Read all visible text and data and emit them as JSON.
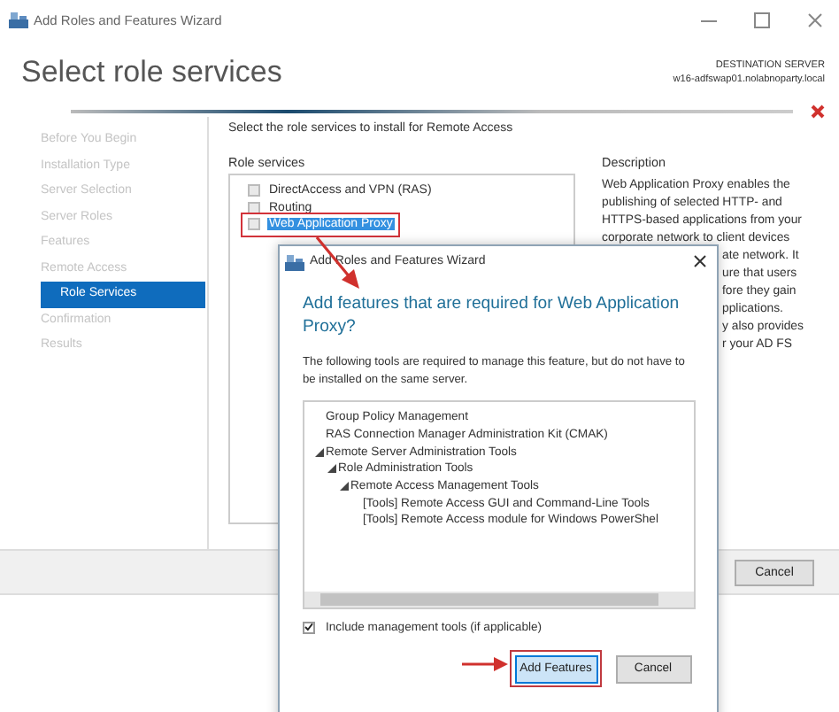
{
  "window": {
    "title": "Add Roles and Features Wizard"
  },
  "header": {
    "title": "Select role services",
    "destination_label": "DESTINATION SERVER",
    "destination_server": "w16-adfswap01.nolabnoparty.local"
  },
  "sidebar": {
    "items": [
      {
        "label": "Before You Begin",
        "selected": false
      },
      {
        "label": "Installation Type",
        "selected": false
      },
      {
        "label": "Server Selection",
        "selected": false
      },
      {
        "label": "Server Roles",
        "selected": false
      },
      {
        "label": "Features",
        "selected": false
      },
      {
        "label": "Remote Access",
        "selected": false
      },
      {
        "label": "Role Services",
        "selected": true
      },
      {
        "label": "Confirmation",
        "selected": false
      },
      {
        "label": "Results",
        "selected": false
      }
    ]
  },
  "content": {
    "instruction": "Select the role services to install for Remote Access",
    "role_services": {
      "heading": "Role services",
      "items": [
        {
          "label": "DirectAccess and VPN (RAS)",
          "checked": false,
          "selected": false,
          "annotated": false
        },
        {
          "label": "Routing",
          "checked": false,
          "selected": false,
          "annotated": false
        },
        {
          "label": "Web Application Proxy",
          "checked": false,
          "selected": true,
          "annotated": true
        }
      ]
    },
    "description": {
      "heading": "Description",
      "lines": [
        {
          "text": "Web Application Proxy enables the",
          "kind": "full"
        },
        {
          "text": "publishing of selected HTTP- and",
          "kind": "full"
        },
        {
          "text": "HTTPS-based applications from your",
          "kind": "full"
        },
        {
          "text": "corporate network to client devices",
          "kind": "full"
        },
        {
          "text": "ate network. It",
          "kind": "cut"
        },
        {
          "text": "ure that users",
          "kind": "cut"
        },
        {
          "text": "fore they gain",
          "kind": "cut"
        },
        {
          "text": "pplications.",
          "kind": "cut"
        },
        {
          "text": "y also provides",
          "kind": "cut"
        },
        {
          "text": "r your AD FS",
          "kind": "cut"
        }
      ]
    }
  },
  "footer": {
    "buttons": [
      "Cancel"
    ]
  },
  "dialog": {
    "title": "Add Roles and Features Wizard",
    "heading": "Add features that are required for Web Application Proxy?",
    "message": "The following tools are required to manage this feature, but do not have to be installed on the same server.",
    "features": [
      {
        "label": "Group Policy Management"
      },
      {
        "label": "RAS Connection Manager Administration Kit (CMAK)"
      },
      {
        "label": "Remote Server Administration Tools",
        "expanded": true,
        "children": [
          {
            "label": "Role Administration Tools",
            "expanded": true,
            "children": [
              {
                "label": "Remote Access Management Tools",
                "expanded": true,
                "children": [
                  {
                    "label": "[Tools] Remote Access GUI and Command-Line Tools"
                  },
                  {
                    "label": "[Tools] Remote Access module for Windows PowerShel"
                  }
                ]
              }
            ]
          }
        ]
      }
    ],
    "include_tools": {
      "label": "Include management tools (if applicable)",
      "checked": true
    },
    "buttons": [
      {
        "label": "Add Features",
        "default": true,
        "annotated": true
      },
      {
        "label": "Cancel",
        "default": false,
        "annotated": false
      }
    ]
  }
}
